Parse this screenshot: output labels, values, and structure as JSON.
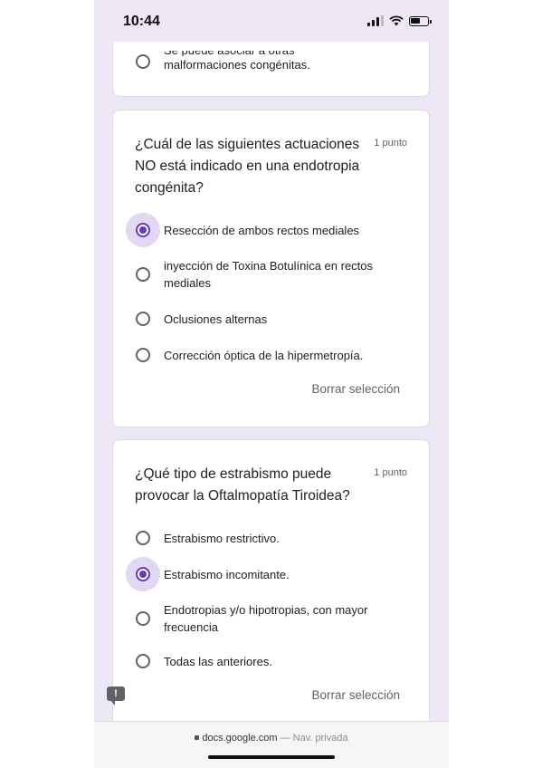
{
  "status_bar": {
    "time": "10:44",
    "signal_icon": "cellular-signal-icon",
    "wifi_icon": "wifi-icon",
    "battery_icon": "battery-icon",
    "battery_level": 0.6
  },
  "prev_question": {
    "partial_option_top": "Se puede asociar a otras",
    "option_label": "malformaciones congénitas."
  },
  "question1": {
    "title": "¿Cuál de las siguientes actuaciones NO está indicado en una endotropia congénita?",
    "points": "1 punto",
    "options": [
      {
        "label": "Resección de ambos rectos mediales",
        "selected": true
      },
      {
        "label": "inyección de Toxina Botulínica en rectos mediales",
        "selected": false
      },
      {
        "label": "Oclusiones alternas",
        "selected": false
      },
      {
        "label": "Corrección óptica de la hipermetropía.",
        "selected": false
      }
    ],
    "clear_label": "Borrar selección"
  },
  "question2": {
    "title": "¿Qué tipo de estrabismo puede provocar la Oftalmopatía Tiroidea?",
    "points": "1 punto",
    "options": [
      {
        "label": "Estrabismo restrictivo.",
        "selected": false
      },
      {
        "label": "Estrabismo incomitante.",
        "selected": true
      },
      {
        "label": "Endotropias y/o hipotropias, con mayor frecuencia",
        "selected": false
      },
      {
        "label": "Todas las anteriores.",
        "selected": false
      }
    ],
    "clear_label": "Borrar selección"
  },
  "feedback_icon": "report-feedback-icon",
  "browser": {
    "url": "docs.google.com",
    "separator": "—",
    "mode": "Nav. privada"
  },
  "colors": {
    "accent": "#673ab7",
    "background": "#ede7f6",
    "selected_halo": "#e0d9f1"
  }
}
